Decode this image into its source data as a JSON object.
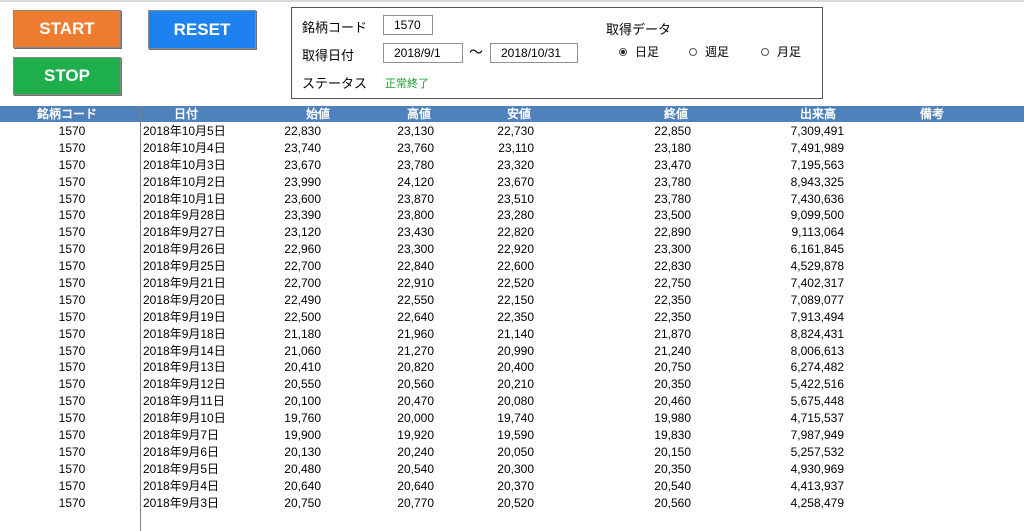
{
  "buttons": {
    "start": "START",
    "stop": "STOP",
    "reset": "RESET"
  },
  "panel": {
    "code_label": "銘柄コード",
    "code_value": "1570",
    "date_label": "取得日付",
    "date_from": "2018/9/1",
    "date_sep": "〜",
    "date_to": "2018/10/31",
    "status_label": "ステータス",
    "status_value": "正常終了",
    "data_label": "取得データ",
    "radio_daily": "日足",
    "radio_weekly": "週足",
    "radio_monthly": "月足",
    "selected": "日足"
  },
  "table": {
    "headers": {
      "code": "銘柄コード",
      "date": "日付",
      "open": "始値",
      "high": "高値",
      "low": "安値",
      "close": "終値",
      "volume": "出来高",
      "note": "備考"
    },
    "rows": [
      {
        "code": "1570",
        "date": "2018年10月5日",
        "open": "22,830",
        "high": "23,130",
        "low": "22,730",
        "close": "22,850",
        "volume": "7,309,491"
      },
      {
        "code": "1570",
        "date": "2018年10月4日",
        "open": "23,740",
        "high": "23,760",
        "low": "23,110",
        "close": "23,180",
        "volume": "7,491,989"
      },
      {
        "code": "1570",
        "date": "2018年10月3日",
        "open": "23,670",
        "high": "23,780",
        "low": "23,320",
        "close": "23,470",
        "volume": "7,195,563"
      },
      {
        "code": "1570",
        "date": "2018年10月2日",
        "open": "23,990",
        "high": "24,120",
        "low": "23,670",
        "close": "23,780",
        "volume": "8,943,325"
      },
      {
        "code": "1570",
        "date": "2018年10月1日",
        "open": "23,600",
        "high": "23,870",
        "low": "23,510",
        "close": "23,780",
        "volume": "7,430,636"
      },
      {
        "code": "1570",
        "date": "2018年9月28日",
        "open": "23,390",
        "high": "23,800",
        "low": "23,280",
        "close": "23,500",
        "volume": "9,099,500"
      },
      {
        "code": "1570",
        "date": "2018年9月27日",
        "open": "23,120",
        "high": "23,430",
        "low": "22,820",
        "close": "22,890",
        "volume": "9,113,064"
      },
      {
        "code": "1570",
        "date": "2018年9月26日",
        "open": "22,960",
        "high": "23,300",
        "low": "22,920",
        "close": "23,300",
        "volume": "6,161,845"
      },
      {
        "code": "1570",
        "date": "2018年9月25日",
        "open": "22,700",
        "high": "22,840",
        "low": "22,600",
        "close": "22,830",
        "volume": "4,529,878"
      },
      {
        "code": "1570",
        "date": "2018年9月21日",
        "open": "22,700",
        "high": "22,910",
        "low": "22,520",
        "close": "22,750",
        "volume": "7,402,317"
      },
      {
        "code": "1570",
        "date": "2018年9月20日",
        "open": "22,490",
        "high": "22,550",
        "low": "22,150",
        "close": "22,350",
        "volume": "7,089,077"
      },
      {
        "code": "1570",
        "date": "2018年9月19日",
        "open": "22,500",
        "high": "22,640",
        "low": "22,350",
        "close": "22,350",
        "volume": "7,913,494"
      },
      {
        "code": "1570",
        "date": "2018年9月18日",
        "open": "21,180",
        "high": "21,960",
        "low": "21,140",
        "close": "21,870",
        "volume": "8,824,431"
      },
      {
        "code": "1570",
        "date": "2018年9月14日",
        "open": "21,060",
        "high": "21,270",
        "low": "20,990",
        "close": "21,240",
        "volume": "8,006,613"
      },
      {
        "code": "1570",
        "date": "2018年9月13日",
        "open": "20,410",
        "high": "20,820",
        "low": "20,400",
        "close": "20,750",
        "volume": "6,274,482"
      },
      {
        "code": "1570",
        "date": "2018年9月12日",
        "open": "20,550",
        "high": "20,560",
        "low": "20,210",
        "close": "20,350",
        "volume": "5,422,516"
      },
      {
        "code": "1570",
        "date": "2018年9月11日",
        "open": "20,100",
        "high": "20,470",
        "low": "20,080",
        "close": "20,460",
        "volume": "5,675,448"
      },
      {
        "code": "1570",
        "date": "2018年9月10日",
        "open": "19,760",
        "high": "20,000",
        "low": "19,740",
        "close": "19,980",
        "volume": "4,715,537"
      },
      {
        "code": "1570",
        "date": "2018年9月7日",
        "open": "19,900",
        "high": "19,920",
        "low": "19,590",
        "close": "19,830",
        "volume": "7,987,949"
      },
      {
        "code": "1570",
        "date": "2018年9月6日",
        "open": "20,130",
        "high": "20,240",
        "low": "20,050",
        "close": "20,150",
        "volume": "5,257,532"
      },
      {
        "code": "1570",
        "date": "2018年9月5日",
        "open": "20,480",
        "high": "20,540",
        "low": "20,300",
        "close": "20,350",
        "volume": "4,930,969"
      },
      {
        "code": "1570",
        "date": "2018年9月4日",
        "open": "20,640",
        "high": "20,640",
        "low": "20,370",
        "close": "20,540",
        "volume": "4,413,937"
      },
      {
        "code": "1570",
        "date": "2018年9月3日",
        "open": "20,750",
        "high": "20,770",
        "low": "20,520",
        "close": "20,560",
        "volume": "4,258,479"
      }
    ]
  }
}
